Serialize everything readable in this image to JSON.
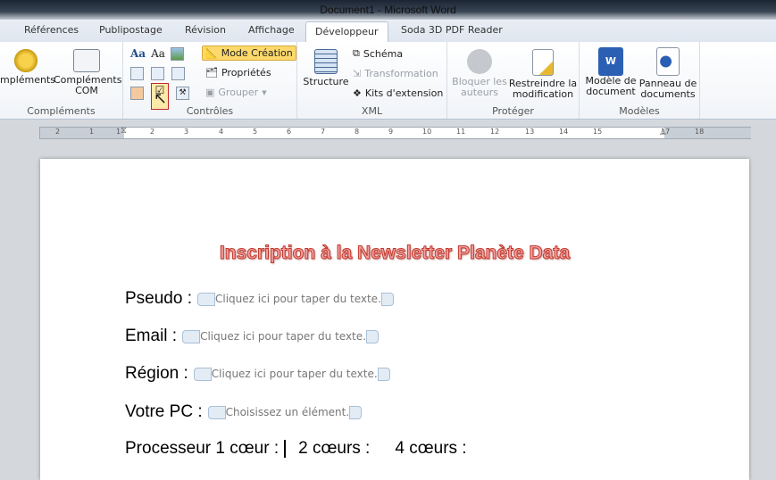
{
  "window": {
    "title": "Document1  -  Microsoft Word"
  },
  "tabs": [
    "Références",
    "Publipostage",
    "Révision",
    "Affichage",
    "Développeur",
    "Soda 3D PDF Reader"
  ],
  "ribbon": {
    "complements": {
      "label": "Compléments",
      "btn1": "mpléments",
      "btn2a": "Compléments",
      "btn2b": "COM"
    },
    "controles": {
      "label": "Contrôles",
      "mode_creation": "Mode Création",
      "proprietes": "Propriétés",
      "grouper": "Grouper"
    },
    "xml": {
      "label": "XML",
      "structure": "Structure",
      "schema": "Schéma",
      "transformation": "Transformation",
      "kits": "Kits d'extension"
    },
    "proteger": {
      "label": "Protéger",
      "bloquer_a": "Bloquer les",
      "bloquer_b": "auteurs",
      "restreindre_a": "Restreindre la",
      "restreindre_b": "modification"
    },
    "modeles": {
      "label": "Modèles",
      "modele_a": "Modèle de",
      "modele_b": "document",
      "panneau_a": "Panneau de",
      "panneau_b": "documents"
    }
  },
  "ruler": {
    "left": [
      "2",
      "1"
    ],
    "right": [
      "1",
      "2",
      "3",
      "4",
      "5",
      "6",
      "7",
      "8",
      "9",
      "10",
      "11",
      "12",
      "13",
      "14",
      "15",
      "17",
      "18"
    ]
  },
  "document": {
    "title": "Inscription à la Newsletter Planète Data",
    "fields": [
      {
        "label": "Pseudo :",
        "placeholder": "Cliquez ici pour taper du texte."
      },
      {
        "label": "Email :",
        "placeholder": "Cliquez ici pour taper du texte."
      },
      {
        "label": "Région :",
        "placeholder": "Cliquez ici pour taper du texte."
      },
      {
        "label": "Votre PC :",
        "placeholder": "Choisissez un élément."
      }
    ],
    "processor": {
      "label": "Processeur 1 cœur :",
      "opt2": "2 cœurs :",
      "opt4": "4 cœurs :"
    }
  }
}
